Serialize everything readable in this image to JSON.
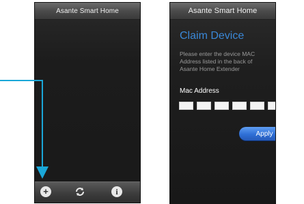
{
  "left_screen": {
    "title": "Asante Smart Home",
    "bottom_bar": {
      "add_icon": "plus-circle-icon",
      "refresh_icon": "refresh-icon",
      "info_icon": "info-icon"
    }
  },
  "right_screen": {
    "title": "Asante Smart Home",
    "heading": "Claim Device",
    "description": "Please enter the device MAC Address listed in the back of Asante Home Extender",
    "mac_label": "Mac Address",
    "mac_fields": [
      "",
      "",
      "",
      "",
      "",
      ""
    ],
    "apply_label": "Apply"
  },
  "colors": {
    "accent": "#1aa7d8",
    "heading": "#3a88d8",
    "button": "#2f6fd6"
  }
}
